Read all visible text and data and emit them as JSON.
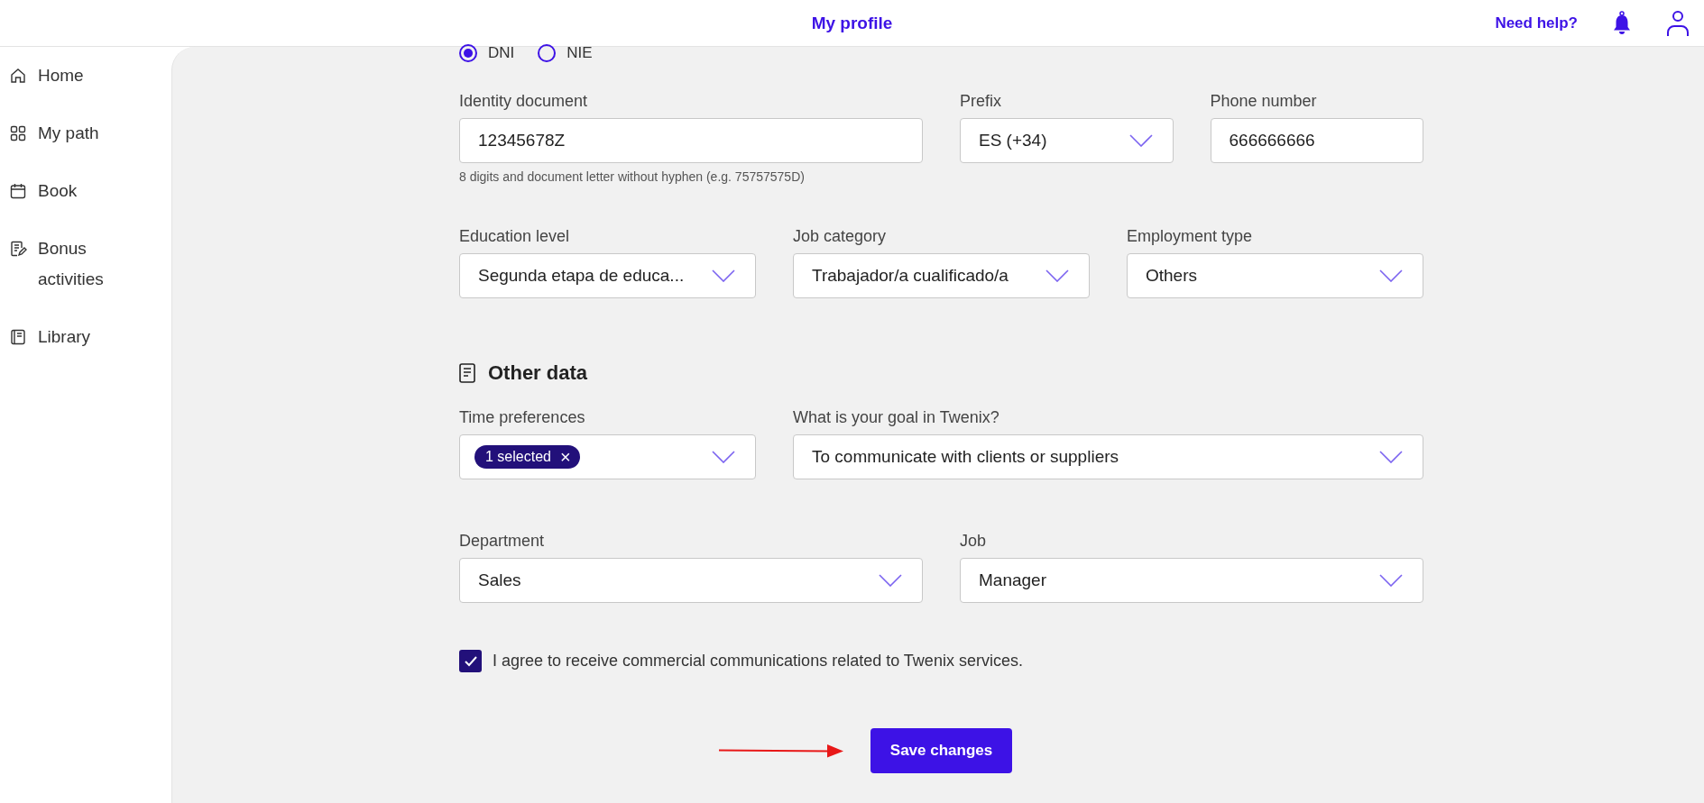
{
  "header": {
    "title": "My profile",
    "help_link": "Need help?"
  },
  "sidebar": {
    "items": [
      {
        "label": "Home"
      },
      {
        "label": "My path"
      },
      {
        "label": "Book"
      },
      {
        "label": "Bonus activities"
      },
      {
        "label": "Library"
      }
    ]
  },
  "document_type": [
    {
      "label": "DNI",
      "selected": true
    },
    {
      "label": "NIE",
      "selected": false
    }
  ],
  "rows": [
    {
      "fields": [
        {
          "label": "Identity document",
          "kind": "input",
          "value": "12345678Z",
          "hint": "8 digits and document letter without hyphen (e.g. 75757575D)"
        },
        {
          "label": "Prefix",
          "kind": "select",
          "value": "ES (+34)"
        },
        {
          "label": "Phone number",
          "kind": "input",
          "value": "666666666"
        }
      ]
    },
    {
      "fields": [
        {
          "label": "Education level",
          "kind": "select",
          "value": "Segunda etapa de educa..."
        },
        {
          "label": "Job category",
          "kind": "select",
          "value": "Trabajador/a cualificado/a"
        },
        {
          "label": "Employment type",
          "kind": "select",
          "value": "Others"
        }
      ]
    }
  ],
  "other_data": {
    "heading": "Other data",
    "rows": [
      {
        "fields": [
          {
            "label": "Time preferences",
            "kind": "chips",
            "chip": "1 selected",
            "chip_symbol": "×"
          },
          {
            "label": "What is your goal in Twenix?",
            "kind": "select",
            "value": "To communicate with clients or suppliers"
          }
        ]
      },
      {
        "fields": [
          {
            "label": "Department",
            "kind": "select",
            "value": "Sales"
          },
          {
            "label": "Job",
            "kind": "select",
            "value": "Manager"
          }
        ]
      }
    ]
  },
  "consent": {
    "label": "I agree to receive commercial communications related to Twenix services.",
    "checked": true
  },
  "save_button": "Save changes"
}
